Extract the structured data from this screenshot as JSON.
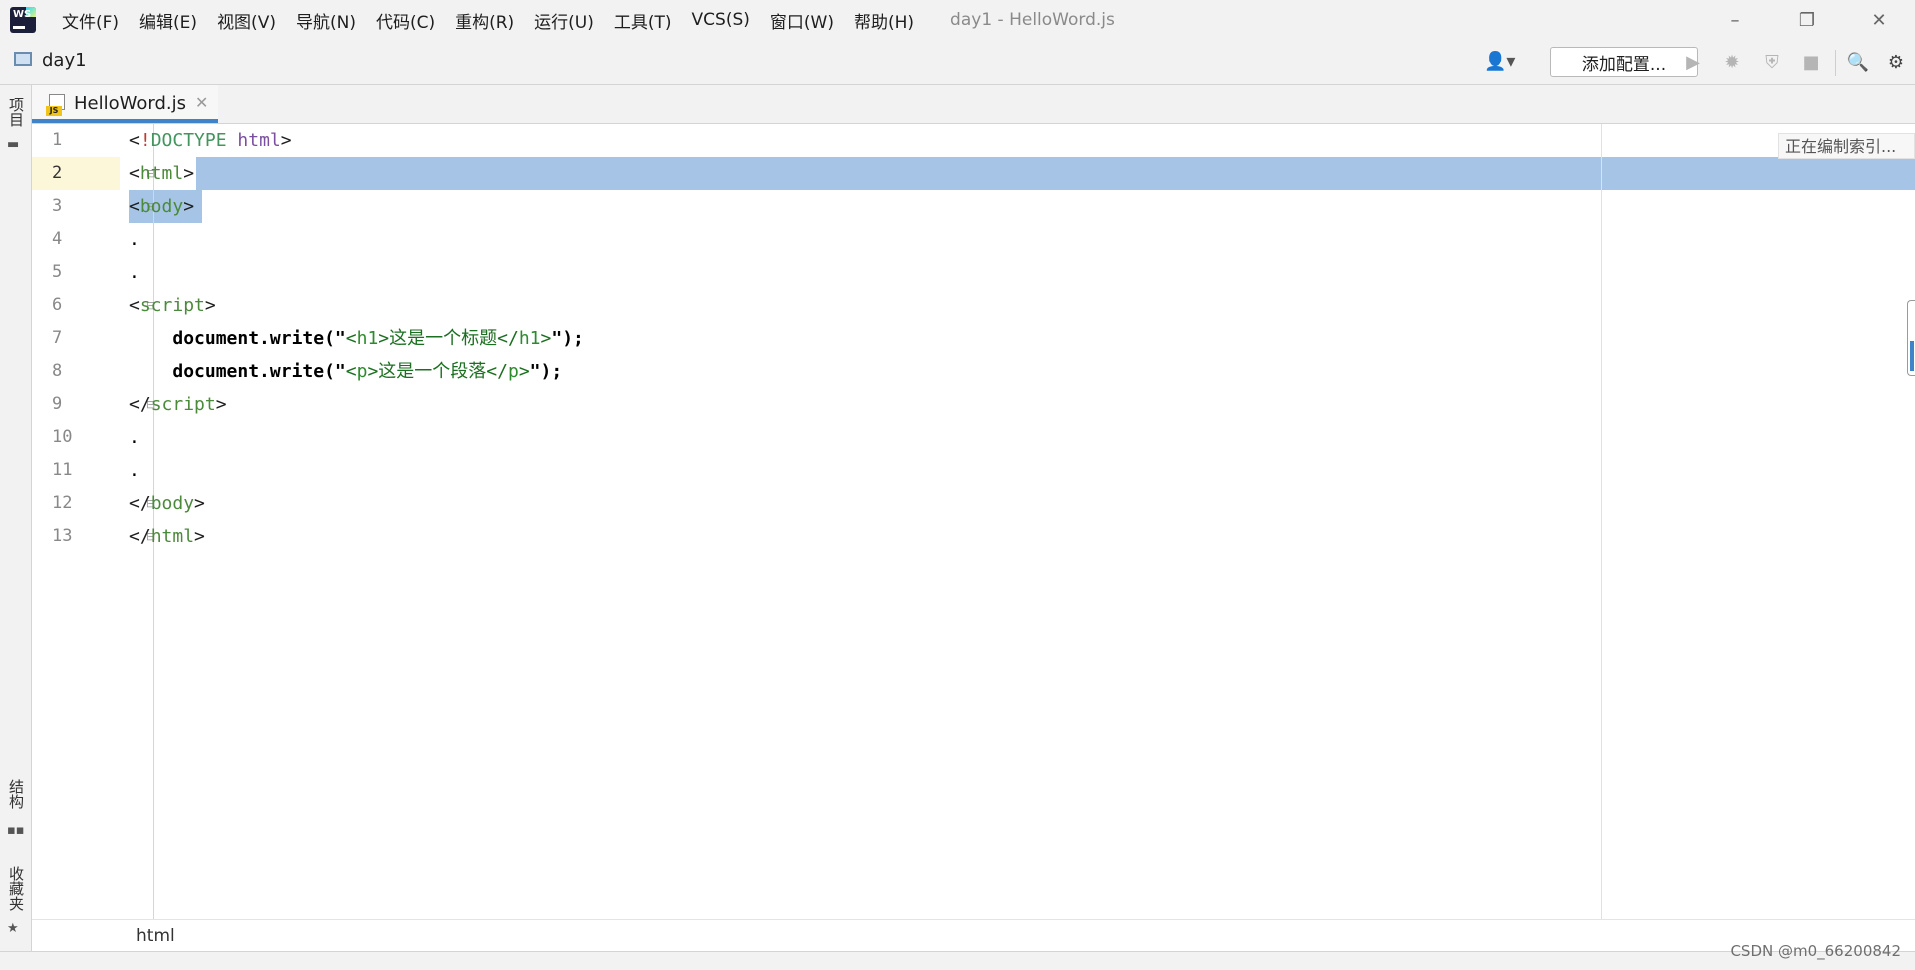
{
  "window": {
    "title": "day1 - HelloWord.js",
    "controls": {
      "minimize": "–",
      "restore": "❐",
      "close": "✕"
    }
  },
  "menu": [
    "文件(F)",
    "编辑(E)",
    "视图(V)",
    "导航(N)",
    "代码(C)",
    "重构(R)",
    "运行(U)",
    "工具(T)",
    "VCS(S)",
    "窗口(W)",
    "帮助(H)"
  ],
  "toolbar": {
    "project": "day1",
    "config_button": "添加配置...",
    "user_glyph": "👤▾",
    "run_glyph": "▶",
    "debug_glyph": "✹",
    "coverage_glyph": "⛨",
    "stop_glyph": "■",
    "search_glyph": "🔍",
    "settings_glyph": "⚙"
  },
  "sidebar": {
    "project_label": "项目",
    "structure_label": "结构",
    "favorites_label": "收藏夹",
    "favorites_star": "★"
  },
  "tab": {
    "label": "HelloWord.js",
    "close": "✕",
    "icon_text": "JS"
  },
  "editor": {
    "line_numbers": [
      "1",
      "2",
      "3",
      "4",
      "5",
      "6",
      "7",
      "8",
      "9",
      "10",
      "11",
      "12",
      "13"
    ],
    "current_line": 2,
    "index_status": "正在编制索引...",
    "fold_glyph": "⊟",
    "code": {
      "l1_lt": "<",
      "l1_bang": "!",
      "l1_doctype": "DOCTYPE",
      "l1_sp": " ",
      "l1_html": "html",
      "l1_gt": ">",
      "l2_lt": "<",
      "l2_tag": "html",
      "l2_gt": ">",
      "l3_lt": "<",
      "l3_tag": "body",
      "l3_gt": ">",
      "l4": ".",
      "l5": ".",
      "l6_lt": "<",
      "l6_tag": "script",
      "l6_gt": ">",
      "l7_indent": "    ",
      "l7_call": "document.write(",
      "l7_q1": "\"",
      "l7_s1": "<",
      "l7_t1": "h1",
      "l7_s2": ">这是一个标题</",
      "l7_t2": "h1",
      "l7_s3": ">",
      "l7_q2": "\"",
      "l7_end": ");",
      "l8_indent": "    ",
      "l8_call": "document.write(",
      "l8_q1": "\"",
      "l8_s1": "<",
      "l8_t1": "p",
      "l8_s2": ">这是一个段落</",
      "l8_t2": "p",
      "l8_s3": ">",
      "l8_q2": "\"",
      "l8_end": ");",
      "l9_lt": "</",
      "l9_tag": "script",
      "l9_gt": ">",
      "l10": ".",
      "l11": ".",
      "l12_lt": "</",
      "l12_tag": "body",
      "l12_gt": ">",
      "l13_lt": "</",
      "l13_tag": "html",
      "l13_gt": ">"
    }
  },
  "breadcrumb_bottom": "html",
  "watermark": "CSDN @m0_66200842",
  "colors": {
    "selection": "#a6c5e6",
    "current_line_gutter": "#fcf7d8",
    "tab_underline": "#4083c9",
    "tag": "#4b8a3a",
    "string": "#1b6f20"
  }
}
